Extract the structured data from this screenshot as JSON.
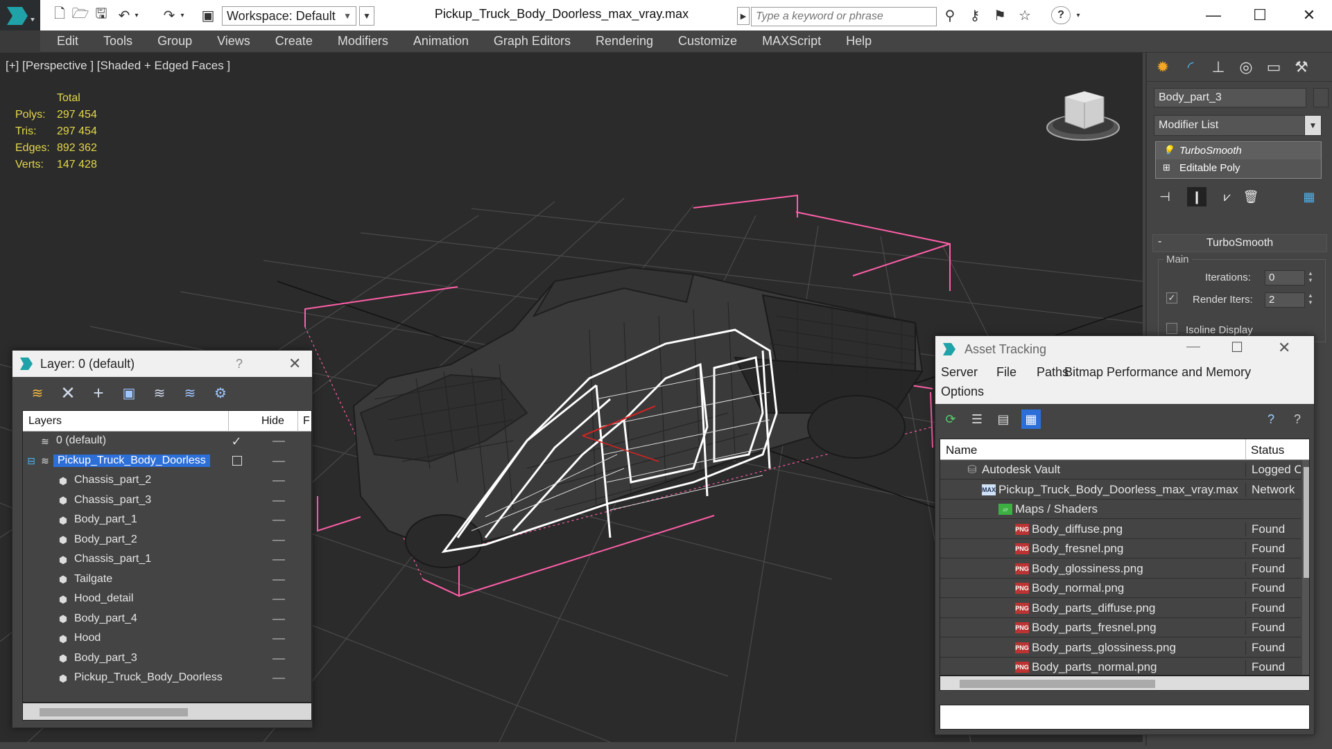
{
  "titlebar": {
    "workspace": "Workspace: Default",
    "file_title": "Pickup_Truck_Body_Doorless_max_vray.max",
    "search_placeholder": "Type a keyword or phrase"
  },
  "menu": [
    "Edit",
    "Tools",
    "Group",
    "Views",
    "Create",
    "Modifiers",
    "Animation",
    "Graph Editors",
    "Rendering",
    "Customize",
    "MAXScript",
    "Help"
  ],
  "viewport": {
    "label": "[+] [Perspective ] [Shaded + Edged Faces ]",
    "stats": {
      "header": "Total",
      "rows": [
        {
          "k": "Polys:",
          "v": "297 454"
        },
        {
          "k": "Tris:",
          "v": "297 454"
        },
        {
          "k": "Edges:",
          "v": "892 362"
        },
        {
          "k": "Verts:",
          "v": "147 428"
        }
      ]
    }
  },
  "command_panel": {
    "object_name": "Body_part_3",
    "modifier_list": "Modifier List",
    "stack": [
      "TurboSmooth",
      "Editable Poly"
    ],
    "rollout": "TurboSmooth",
    "group": "Main",
    "iterations_label": "Iterations:",
    "iterations": "0",
    "render_iters_label": "Render Iters:",
    "render_iters": "2",
    "isoline_label": "Isoline Display"
  },
  "layer_window": {
    "title": "Layer: 0 (default)",
    "help": "?",
    "col_layers": "Layers",
    "col_hide": "Hide",
    "col_f": "F",
    "rows": [
      {
        "name": "0 (default)",
        "level": 0,
        "type": "layer",
        "active": true
      },
      {
        "name": "Pickup_Truck_Body_Doorless",
        "level": 0,
        "type": "layer",
        "selected": true
      },
      {
        "name": "Chassis_part_2",
        "level": 1,
        "type": "object"
      },
      {
        "name": "Chassis_part_3",
        "level": 1,
        "type": "object"
      },
      {
        "name": "Body_part_1",
        "level": 1,
        "type": "object"
      },
      {
        "name": "Body_part_2",
        "level": 1,
        "type": "object"
      },
      {
        "name": "Chassis_part_1",
        "level": 1,
        "type": "object"
      },
      {
        "name": "Tailgate",
        "level": 1,
        "type": "object"
      },
      {
        "name": "Hood_detail",
        "level": 1,
        "type": "object"
      },
      {
        "name": "Body_part_4",
        "level": 1,
        "type": "object"
      },
      {
        "name": "Hood",
        "level": 1,
        "type": "object"
      },
      {
        "name": "Body_part_3",
        "level": 1,
        "type": "object"
      },
      {
        "name": "Pickup_Truck_Body_Doorless",
        "level": 1,
        "type": "object"
      }
    ]
  },
  "asset_window": {
    "title": "Asset Tracking",
    "menu": [
      "Server",
      "File",
      "Paths",
      "Bitmap Performance and Memory",
      "Options"
    ],
    "col_name": "Name",
    "col_status": "Status",
    "rows": [
      {
        "name": "Autodesk Vault",
        "status": "Logged O",
        "level": 0,
        "icon": "vault-icon"
      },
      {
        "name": "Pickup_Truck_Body_Doorless_max_vray.max",
        "status": "Network",
        "level": 1,
        "icon": "max-file-icon"
      },
      {
        "name": "Maps / Shaders",
        "status": "",
        "level": 2,
        "icon": "maps-icon"
      },
      {
        "name": "Body_diffuse.png",
        "status": "Found",
        "level": 3,
        "icon": "png-icon"
      },
      {
        "name": "Body_fresnel.png",
        "status": "Found",
        "level": 3,
        "icon": "png-icon"
      },
      {
        "name": "Body_glossiness.png",
        "status": "Found",
        "level": 3,
        "icon": "png-icon"
      },
      {
        "name": "Body_normal.png",
        "status": "Found",
        "level": 3,
        "icon": "png-icon"
      },
      {
        "name": "Body_parts_diffuse.png",
        "status": "Found",
        "level": 3,
        "icon": "png-icon"
      },
      {
        "name": "Body_parts_fresnel.png",
        "status": "Found",
        "level": 3,
        "icon": "png-icon"
      },
      {
        "name": "Body_parts_glossiness.png",
        "status": "Found",
        "level": 3,
        "icon": "png-icon"
      },
      {
        "name": "Body_parts_normal.png",
        "status": "Found",
        "level": 3,
        "icon": "png-icon"
      }
    ],
    "png_badge": "PNG"
  },
  "colors": {
    "stats": "#e4d84a",
    "selection": "#2d6fd8",
    "bbox": "#ff5fa8",
    "wire_selected": "#ffffff"
  }
}
